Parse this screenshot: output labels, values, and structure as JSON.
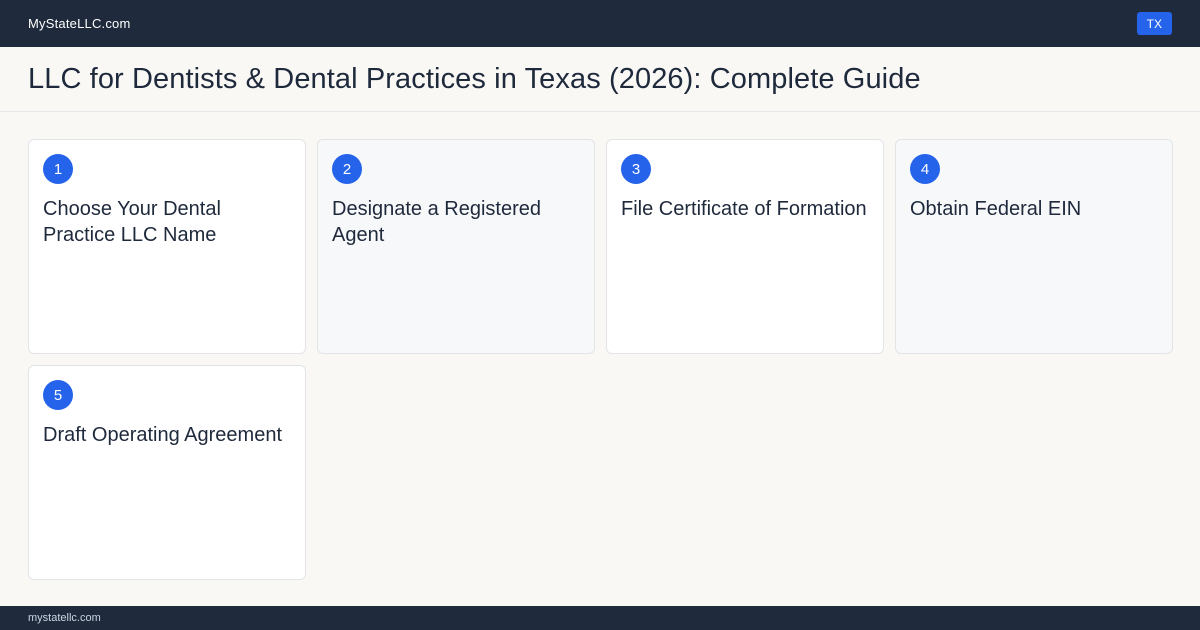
{
  "header": {
    "brand": "MyStateLLC.com",
    "state_badge": "TX"
  },
  "page": {
    "title": "LLC for Dentists & Dental Practices in Texas (2026): Complete Guide"
  },
  "steps": [
    {
      "number": "1",
      "title": "Choose Your Dental Practice LLC Name"
    },
    {
      "number": "2",
      "title": "Designate a Registered Agent"
    },
    {
      "number": "3",
      "title": "File Certificate of Formation"
    },
    {
      "number": "4",
      "title": "Obtain Federal EIN"
    },
    {
      "number": "5",
      "title": "Draft Operating Agreement"
    }
  ],
  "footer": {
    "domain": "mystatellc.com"
  },
  "colors": {
    "nav_bg": "#1f2a3c",
    "accent": "#2563eb",
    "page_bg": "#f9f8f5"
  }
}
